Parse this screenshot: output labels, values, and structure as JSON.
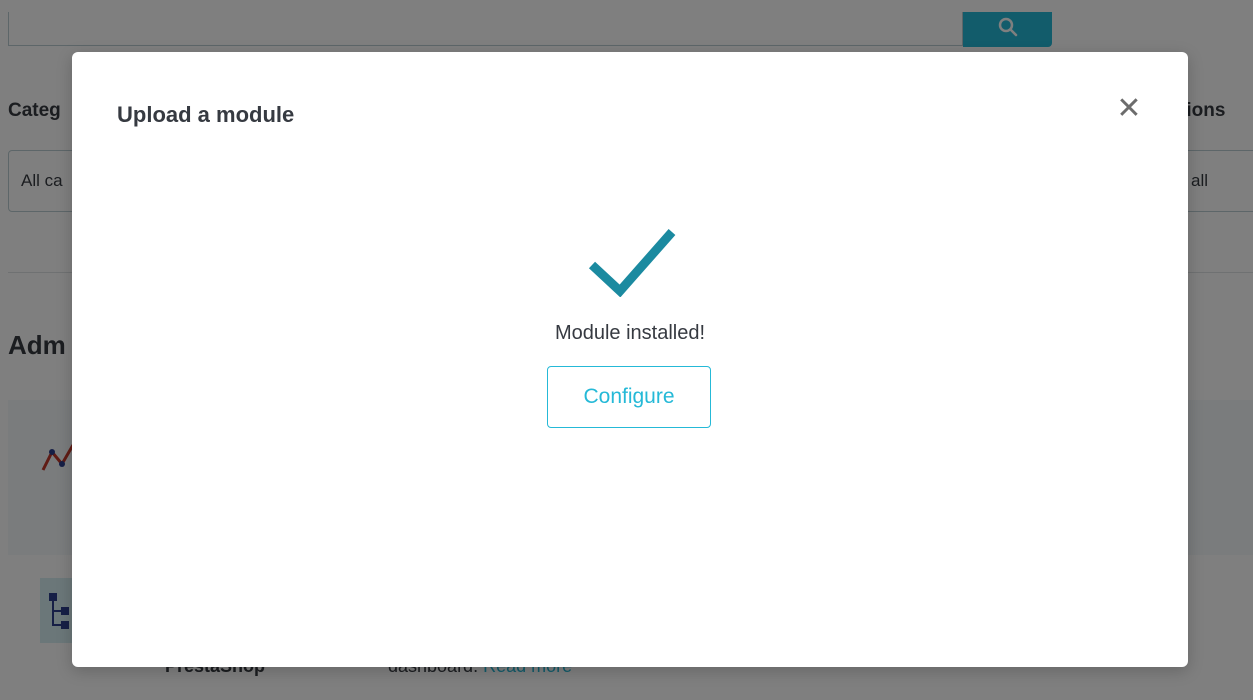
{
  "background": {
    "search_icon": "search-icon",
    "category_label": "Categ",
    "category_select_value": "All ca",
    "actions_label": "tions",
    "install_select_value": "all",
    "section_title": "Adm",
    "module_2_name": "PrestaShop",
    "module_2_desc": "dashboard.",
    "module_2_read_more": "Read more"
  },
  "modal": {
    "title": "Upload a module",
    "close_glyph": "✕",
    "status_text": "Module installed!",
    "configure_label": "Configure",
    "accent_color": "#25b9d7",
    "check_color": "#1b8aa0"
  }
}
